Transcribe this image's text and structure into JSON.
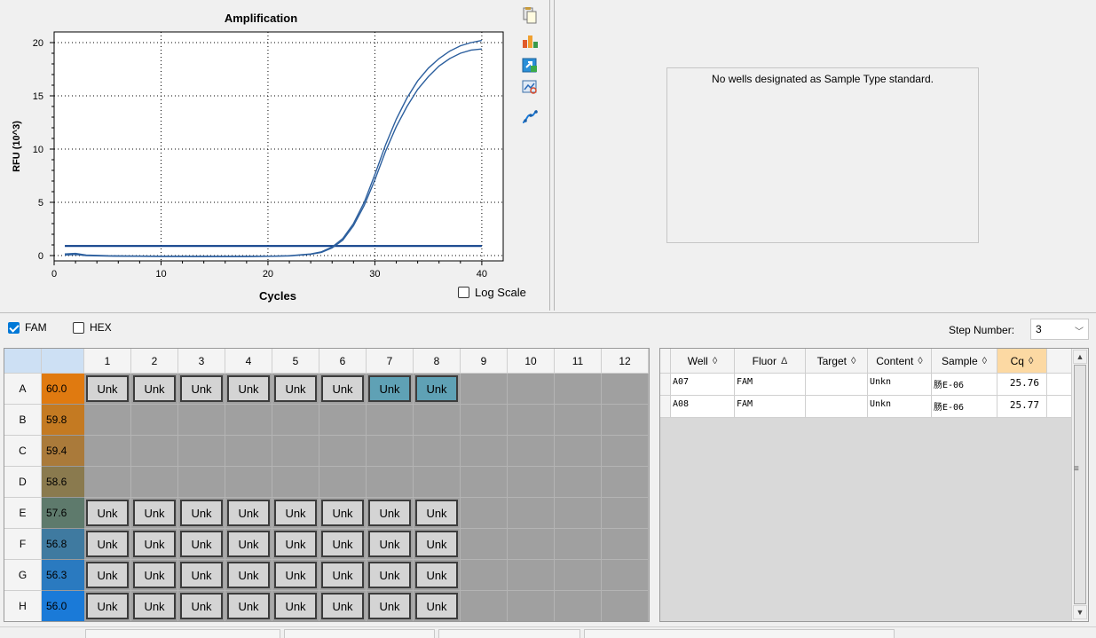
{
  "chart": {
    "title": "Amplification",
    "xlabel": "Cycles",
    "ylabel": "RFU (10^3)",
    "log_scale_label": "Log Scale",
    "log_scale_checked": false,
    "toolbar_icons": [
      "copy-icon",
      "chart-options-icon",
      "export-icon",
      "zoom-icon",
      "curve-fit-icon"
    ]
  },
  "chart_data": {
    "type": "line",
    "title": "Amplification",
    "xlabel": "Cycles",
    "ylabel": "RFU (10^3)",
    "xlim": [
      0,
      42
    ],
    "ylim": [
      -0.5,
      21
    ],
    "x_ticks": [
      0,
      10,
      20,
      30,
      40
    ],
    "y_ticks": [
      0,
      5,
      10,
      15,
      20
    ],
    "grid": true,
    "grid_style": "dotted",
    "threshold": 0.9,
    "series": [
      {
        "x": [
          1,
          2,
          3,
          5,
          8,
          10,
          14,
          18,
          20,
          22,
          24,
          25,
          26,
          27,
          28,
          29,
          30,
          31,
          32,
          33,
          34,
          35,
          36,
          37,
          38,
          39,
          40
        ],
        "values": [
          0.15,
          0.2,
          0.05,
          -0.02,
          -0.05,
          -0.07,
          -0.08,
          -0.08,
          -0.07,
          -0.02,
          0.15,
          0.35,
          0.8,
          1.6,
          3.0,
          5.0,
          7.6,
          10.4,
          12.8,
          14.8,
          16.4,
          17.6,
          18.5,
          19.2,
          19.7,
          20.0,
          20.2
        ]
      },
      {
        "x": [
          1,
          2,
          3,
          5,
          8,
          10,
          14,
          18,
          20,
          22,
          24,
          25,
          26,
          27,
          28,
          29,
          30,
          31,
          32,
          33,
          34,
          35,
          36,
          37,
          38,
          39,
          40
        ],
        "values": [
          0.05,
          0.1,
          0.0,
          -0.05,
          -0.07,
          -0.08,
          -0.08,
          -0.08,
          -0.07,
          -0.03,
          0.12,
          0.3,
          0.72,
          1.45,
          2.8,
          4.7,
          7.1,
          9.8,
          12.1,
          14.0,
          15.6,
          16.8,
          17.8,
          18.5,
          19.0,
          19.3,
          19.4
        ]
      }
    ]
  },
  "std_curve": {
    "message": "No wells designated as Sample Type standard."
  },
  "fluors": [
    {
      "label": "FAM",
      "checked": true
    },
    {
      "label": "HEX",
      "checked": false
    }
  ],
  "step": {
    "label": "Step Number:",
    "value": "3"
  },
  "plate": {
    "columns": [
      "1",
      "2",
      "3",
      "4",
      "5",
      "6",
      "7",
      "8",
      "9",
      "10",
      "11",
      "12"
    ],
    "rows": [
      {
        "label": "A",
        "temp": "60.0",
        "temp_color": "#e07a10",
        "wells": [
          "Unk",
          "Unk",
          "Unk",
          "Unk",
          "Unk",
          "Unk",
          "Unk",
          "Unk",
          "",
          "",
          "",
          ""
        ],
        "selected": [
          false,
          false,
          false,
          false,
          false,
          false,
          true,
          true
        ]
      },
      {
        "label": "B",
        "temp": "59.8",
        "temp_color": "#c47a22",
        "wells": [
          "",
          "",
          "",
          "",
          "",
          "",
          "",
          "",
          "",
          "",
          "",
          ""
        ],
        "selected": []
      },
      {
        "label": "C",
        "temp": "59.4",
        "temp_color": "#aa7a3a",
        "wells": [
          "",
          "",
          "",
          "",
          "",
          "",
          "",
          "",
          "",
          "",
          "",
          ""
        ],
        "selected": []
      },
      {
        "label": "D",
        "temp": "58.6",
        "temp_color": "#8a7a4e",
        "wells": [
          "",
          "",
          "",
          "",
          "",
          "",
          "",
          "",
          "",
          "",
          "",
          ""
        ],
        "selected": []
      },
      {
        "label": "E",
        "temp": "57.6",
        "temp_color": "#5e7a6c",
        "wells": [
          "Unk",
          "Unk",
          "Unk",
          "Unk",
          "Unk",
          "Unk",
          "Unk",
          "Unk",
          "",
          "",
          "",
          ""
        ],
        "selected": []
      },
      {
        "label": "F",
        "temp": "56.8",
        "temp_color": "#3f7aa0",
        "wells": [
          "Unk",
          "Unk",
          "Unk",
          "Unk",
          "Unk",
          "Unk",
          "Unk",
          "Unk",
          "",
          "",
          "",
          ""
        ],
        "selected": []
      },
      {
        "label": "G",
        "temp": "56.3",
        "temp_color": "#2a7ac0",
        "wells": [
          "Unk",
          "Unk",
          "Unk",
          "Unk",
          "Unk",
          "Unk",
          "Unk",
          "Unk",
          "",
          "",
          "",
          ""
        ],
        "selected": []
      },
      {
        "label": "H",
        "temp": "56.0",
        "temp_color": "#1a7ad8",
        "wells": [
          "Unk",
          "Unk",
          "Unk",
          "Unk",
          "Unk",
          "Unk",
          "Unk",
          "Unk",
          "",
          "",
          "",
          ""
        ],
        "selected": []
      }
    ]
  },
  "results": {
    "columns": [
      {
        "label": "Well",
        "sort": "◊"
      },
      {
        "label": "Fluor",
        "sort": "Δ"
      },
      {
        "label": "Target",
        "sort": "◊"
      },
      {
        "label": "Content",
        "sort": "◊"
      },
      {
        "label": "Sample",
        "sort": "◊"
      },
      {
        "label": "Cq",
        "sort": "◊"
      }
    ],
    "rows": [
      [
        "A07",
        "FAM",
        "",
        "Unkn",
        "肠E-06",
        "25.76"
      ],
      [
        "A08",
        "FAM",
        "",
        "Unkn",
        "肠E-06",
        "25.77"
      ]
    ]
  }
}
